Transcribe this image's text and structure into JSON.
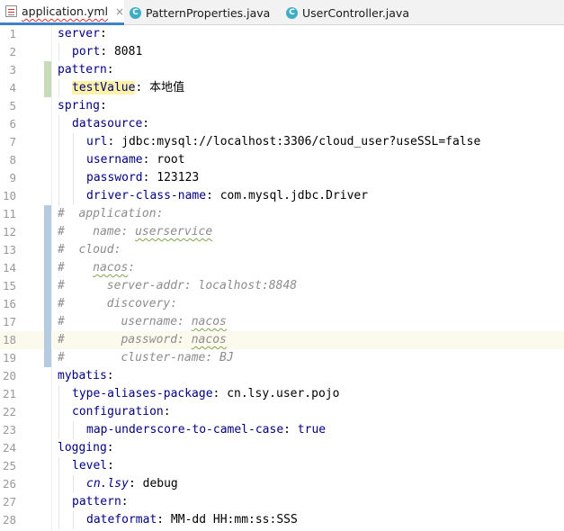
{
  "tabs": [
    {
      "label": "application.yml",
      "icon": "yml-file-icon",
      "active": true,
      "closable": true
    },
    {
      "label": "PatternProperties.java",
      "icon": "java-class-icon",
      "active": false,
      "closable": false
    },
    {
      "label": "UserController.java",
      "icon": "java-class-icon",
      "active": false,
      "closable": false
    }
  ],
  "close_glyph": "×",
  "java_glyph": "C",
  "highlighted_line": 18,
  "colors": {
    "key": "#000080",
    "comment": "#8c8c8c",
    "tab_active_underline": "#4083c9",
    "vcs_modified": "#b4cbe2",
    "vcs_added": "#c9dcba"
  },
  "lines": [
    {
      "n": "1",
      "indent": 0,
      "key": "server",
      "sep": ":",
      "value": "",
      "comment": false
    },
    {
      "n": "2",
      "indent": 1,
      "key": "port",
      "sep": ":",
      "value": " 8081",
      "comment": false
    },
    {
      "n": "3",
      "indent": 0,
      "key": "pattern",
      "sep": ":",
      "value": "",
      "comment": false,
      "vcs": "added"
    },
    {
      "n": "4",
      "indent": 1,
      "key": "testValue",
      "sep": ":",
      "value": " 本地值",
      "comment": false,
      "vcs": "added",
      "keyhl": true
    },
    {
      "n": "5",
      "indent": 0,
      "key": "spring",
      "sep": ":",
      "value": "",
      "comment": false
    },
    {
      "n": "6",
      "indent": 1,
      "key": "datasource",
      "sep": ":",
      "value": "",
      "comment": false
    },
    {
      "n": "7",
      "indent": 2,
      "key": "url",
      "sep": ":",
      "value": " jdbc:mysql://localhost:3306/cloud_user?useSSL=false",
      "comment": false
    },
    {
      "n": "8",
      "indent": 2,
      "key": "username",
      "sep": ":",
      "value": " root",
      "comment": false
    },
    {
      "n": "9",
      "indent": 2,
      "key": "password",
      "sep": ":",
      "value": " 123123",
      "comment": false
    },
    {
      "n": "10",
      "indent": 2,
      "key": "driver-class-name",
      "sep": ":",
      "value": " com.mysql.jdbc.Driver",
      "comment": false
    },
    {
      "n": "11",
      "text": "#  application:",
      "comment": true,
      "vcs": "modified"
    },
    {
      "n": "12",
      "text": "#    name: userservice",
      "comment": true,
      "vcs": "modified"
    },
    {
      "n": "13",
      "text": "#  cloud:",
      "comment": true,
      "vcs": "modified"
    },
    {
      "n": "14",
      "text": "#    nacos:",
      "comment": true,
      "vcs": "modified"
    },
    {
      "n": "15",
      "text": "#      server-addr: localhost:8848",
      "comment": true,
      "vcs": "modified"
    },
    {
      "n": "16",
      "text": "#      discovery:",
      "comment": true,
      "vcs": "modified"
    },
    {
      "n": "17",
      "text": "#        username: nacos",
      "comment": true,
      "vcs": "modified"
    },
    {
      "n": "18",
      "text": "#        password: nacos",
      "comment": true,
      "vcs": "modified"
    },
    {
      "n": "19",
      "text": "#        cluster-name: BJ",
      "comment": true,
      "vcs": "modified"
    },
    {
      "n": "20",
      "indent": 0,
      "key": "mybatis",
      "sep": ":",
      "value": "",
      "comment": false
    },
    {
      "n": "21",
      "indent": 1,
      "key": "type-aliases-package",
      "sep": ":",
      "value": " cn.lsy.user.pojo",
      "comment": false
    },
    {
      "n": "22",
      "indent": 1,
      "key": "configuration",
      "sep": ":",
      "value": "",
      "comment": false
    },
    {
      "n": "23",
      "indent": 2,
      "key": "map-underscore-to-camel-case",
      "sep": ":",
      "value": " true",
      "comment": false,
      "valuecolor": "kw"
    },
    {
      "n": "24",
      "indent": 0,
      "key": "logging",
      "sep": ":",
      "value": "",
      "comment": false
    },
    {
      "n": "25",
      "indent": 1,
      "key": "level",
      "sep": ":",
      "value": "",
      "comment": false
    },
    {
      "n": "26",
      "indent": 2,
      "key": "cn.lsy",
      "sep": ":",
      "value": " debug",
      "comment": false,
      "italickey": true
    },
    {
      "n": "27",
      "indent": 1,
      "key": "pattern",
      "sep": ":",
      "value": "",
      "comment": false
    },
    {
      "n": "28",
      "indent": 2,
      "key": "dateformat",
      "sep": ":",
      "value": " MM-dd HH:mm:ss:SSS",
      "comment": false
    }
  ]
}
